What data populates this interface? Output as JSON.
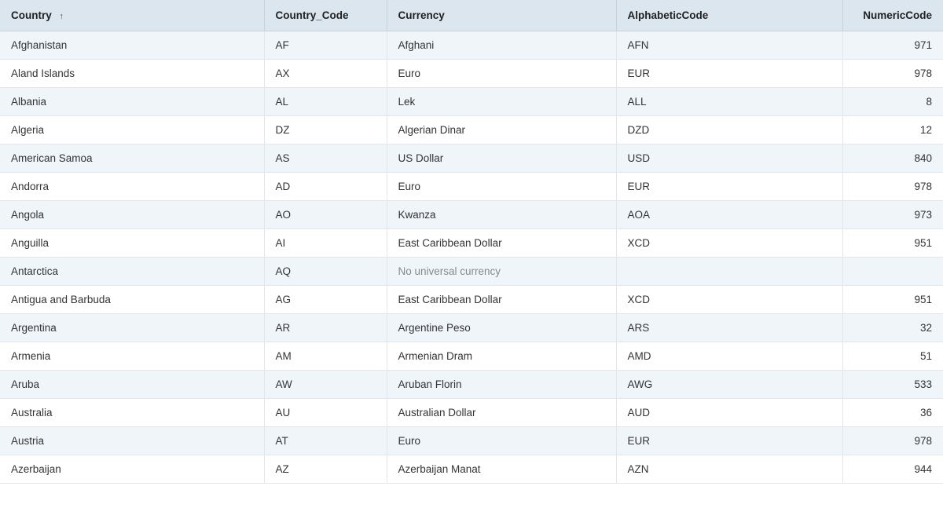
{
  "table": {
    "columns": [
      {
        "key": "country",
        "label": "Country",
        "sortable": true,
        "sort_direction": "asc"
      },
      {
        "key": "country_code",
        "label": "Country_Code"
      },
      {
        "key": "currency",
        "label": "Currency"
      },
      {
        "key": "alphabetic_code",
        "label": "AlphabeticCode"
      },
      {
        "key": "numeric_code",
        "label": "NumericCode"
      }
    ],
    "rows": [
      {
        "country": "Afghanistan",
        "country_code": "AF",
        "currency": "Afghani",
        "alphabetic_code": "AFN",
        "numeric_code": "971"
      },
      {
        "country": "Aland Islands",
        "country_code": "AX",
        "currency": "Euro",
        "alphabetic_code": "EUR",
        "numeric_code": "978"
      },
      {
        "country": "Albania",
        "country_code": "AL",
        "currency": "Lek",
        "alphabetic_code": "ALL",
        "numeric_code": "8"
      },
      {
        "country": "Algeria",
        "country_code": "DZ",
        "currency": "Algerian Dinar",
        "alphabetic_code": "DZD",
        "numeric_code": "12"
      },
      {
        "country": "American Samoa",
        "country_code": "AS",
        "currency": "US Dollar",
        "alphabetic_code": "USD",
        "numeric_code": "840"
      },
      {
        "country": "Andorra",
        "country_code": "AD",
        "currency": "Euro",
        "alphabetic_code": "EUR",
        "numeric_code": "978"
      },
      {
        "country": "Angola",
        "country_code": "AO",
        "currency": "Kwanza",
        "alphabetic_code": "AOA",
        "numeric_code": "973"
      },
      {
        "country": "Anguilla",
        "country_code": "AI",
        "currency": "East Caribbean Dollar",
        "alphabetic_code": "XCD",
        "numeric_code": "951"
      },
      {
        "country": "Antarctica",
        "country_code": "AQ",
        "currency": "No universal currency",
        "alphabetic_code": "",
        "numeric_code": "",
        "no_currency": true
      },
      {
        "country": "Antigua and Barbuda",
        "country_code": "AG",
        "currency": "East Caribbean Dollar",
        "alphabetic_code": "XCD",
        "numeric_code": "951"
      },
      {
        "country": "Argentina",
        "country_code": "AR",
        "currency": "Argentine Peso",
        "alphabetic_code": "ARS",
        "numeric_code": "32"
      },
      {
        "country": "Armenia",
        "country_code": "AM",
        "currency": "Armenian Dram",
        "alphabetic_code": "AMD",
        "numeric_code": "51"
      },
      {
        "country": "Aruba",
        "country_code": "AW",
        "currency": "Aruban Florin",
        "alphabetic_code": "AWG",
        "numeric_code": "533"
      },
      {
        "country": "Australia",
        "country_code": "AU",
        "currency": "Australian Dollar",
        "alphabetic_code": "AUD",
        "numeric_code": "36"
      },
      {
        "country": "Austria",
        "country_code": "AT",
        "currency": "Euro",
        "alphabetic_code": "EUR",
        "numeric_code": "978"
      },
      {
        "country": "Azerbaijan",
        "country_code": "AZ",
        "currency": "Azerbaijan Manat",
        "alphabetic_code": "AZN",
        "numeric_code": "944"
      }
    ],
    "sort_icon": "↑"
  }
}
